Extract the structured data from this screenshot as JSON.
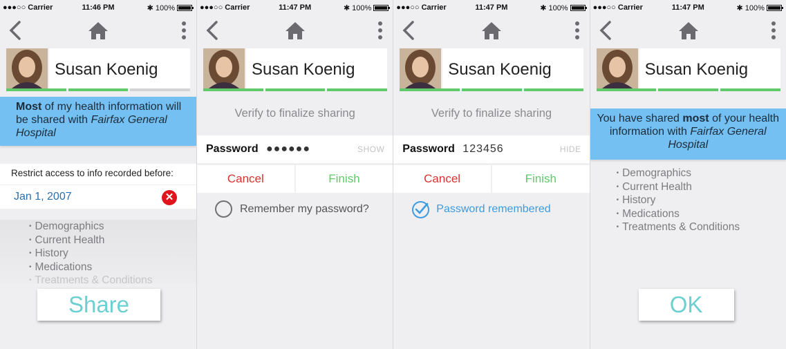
{
  "status": {
    "carrier": "●●●○○ Carrier",
    "times": [
      "11:46 PM",
      "11:47 PM",
      "11:47 PM",
      "11:47 PM"
    ],
    "battery": "100%"
  },
  "profile": {
    "name": "Susan Koenig"
  },
  "screen1": {
    "banner": {
      "bold": "Most",
      "text": " of my health information will be shared with ",
      "hospital": "Fairfax General Hospital"
    },
    "restrict_label": "Restrict access to info recorded before:",
    "date_value": "Jan 1, 2007",
    "items": [
      "Demographics",
      "Current Health",
      "History",
      "Medications",
      "Treatments & Conditions"
    ],
    "share_label": "Share",
    "progress": [
      true,
      true,
      false
    ]
  },
  "screen2": {
    "verify_text": "Verify to finalize sharing",
    "password_label": "Password",
    "password_value": "●●●●●●",
    "toggle_label": "SHOW",
    "cancel_label": "Cancel",
    "finish_label": "Finish",
    "remember_label": "Remember my password?"
  },
  "screen3": {
    "verify_text": "Verify to finalize sharing",
    "password_label": "Password",
    "password_value": "123456",
    "toggle_label": "HIDE",
    "cancel_label": "Cancel",
    "finish_label": "Finish",
    "remember_label": "Password remembered"
  },
  "screen4": {
    "banner": {
      "text1": "You have shared ",
      "bold": "most",
      "text2": " of your health information with ",
      "hospital": "Fairfax General Hospital"
    },
    "items": [
      "Demographics",
      "Current Health",
      "History",
      "Medications",
      "Treatments & Conditions"
    ],
    "ok_label": "OK"
  },
  "colors": {
    "banner": "#74c0f2",
    "progress": "#5fc96b",
    "accent_teal": "#6ccfd1",
    "cancel": "#d4342f"
  }
}
